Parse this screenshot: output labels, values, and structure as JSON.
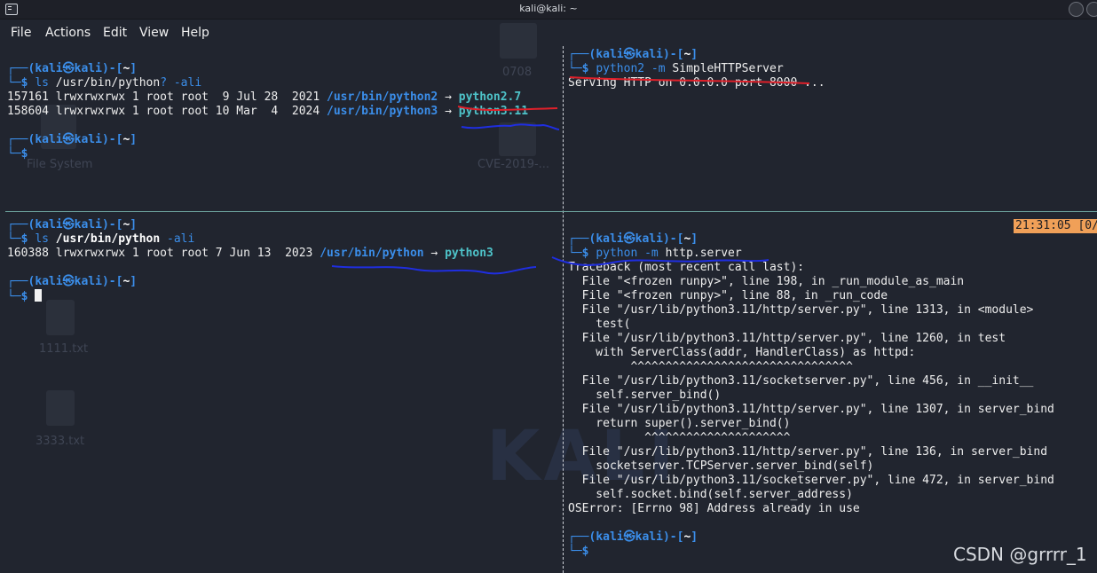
{
  "window": {
    "title": "kali@kali: ~"
  },
  "menubar": {
    "items": [
      "File",
      "Actions",
      "Edit",
      "View",
      "Help"
    ]
  },
  "desktop": {
    "icons": [
      "File System",
      "0708",
      "CVE-2019-...",
      "1111.txt",
      "3333.txt"
    ],
    "wallpaper_text": "KALI"
  },
  "prompt": {
    "open": "┌──(",
    "user": "kali",
    "at": "㉿",
    "host": "kali",
    "mid": ")-[",
    "dir": "~",
    "close": "]",
    "end": "└─",
    "sym": "$"
  },
  "pane_top_left": {
    "cmd": {
      "bin": "ls",
      "path": "/usr/bin/python",
      "glob": "?",
      "flag": " -ali"
    },
    "rows": [
      {
        "meta": "157161 lrwxrwxrwx 1 root root  9 Jul 28  2021 ",
        "link": "/usr/bin/python2",
        "arrow": " → ",
        "target": "python2.7"
      },
      {
        "meta": "158604 lrwxrwxrwx 1 root root 10 Mar  4  2024 ",
        "link": "/usr/bin/python3",
        "arrow": " → ",
        "target": "python3.11"
      }
    ]
  },
  "pane_top_right": {
    "cmd": {
      "bin": "python2",
      "flag": " -m",
      "arg": " SimpleHTTPServer"
    },
    "output": "Serving HTTP on 0.0.0.0 port 8000 ..."
  },
  "pane_bottom_left": {
    "cmd": {
      "bin": "ls",
      "path": " /usr/bin/python",
      "flag": " -ali"
    },
    "row": {
      "meta": "160388 lrwxrwxrwx 1 root root 7 Jun 13  2023 ",
      "link": "/usr/bin/python",
      "arrow": " → ",
      "target": "python3"
    }
  },
  "pane_bottom_right": {
    "clock": "21:31:05 [0/",
    "cmd": {
      "bin": "python",
      "flag": " -m",
      "arg": " http.server"
    },
    "traceback": [
      "Traceback (most recent call last):",
      "  File \"<frozen runpy>\", line 198, in _run_module_as_main",
      "  File \"<frozen runpy>\", line 88, in _run_code",
      "  File \"/usr/lib/python3.11/http/server.py\", line 1313, in <module>",
      "    test(",
      "  File \"/usr/lib/python3.11/http/server.py\", line 1260, in test",
      "    with ServerClass(addr, HandlerClass) as httpd:",
      "         ^^^^^^^^^^^^^^^^^^^^^^^^^^^^^^^^",
      "  File \"/usr/lib/python3.11/socketserver.py\", line 456, in __init__",
      "    self.server_bind()",
      "  File \"/usr/lib/python3.11/http/server.py\", line 1307, in server_bind",
      "    return super().server_bind()",
      "           ^^^^^^^^^^^^^^^^^^^^^",
      "  File \"/usr/lib/python3.11/http/server.py\", line 136, in server_bind",
      "    socketserver.TCPServer.server_bind(self)",
      "  File \"/usr/lib/python3.11/socketserver.py\", line 472, in server_bind",
      "    self.socket.bind(self.server_address)",
      "OSError: [Errno 98] Address already in use"
    ]
  },
  "watermark": "CSDN @grrrr_1",
  "colors": {
    "background": "#21252f",
    "prompt_blue": "#3b8eea",
    "link_cyan": "#4ec3c9",
    "clock_bg": "#f0a058",
    "ink_red": "#e0202a",
    "ink_blue": "#1f2ee0"
  }
}
